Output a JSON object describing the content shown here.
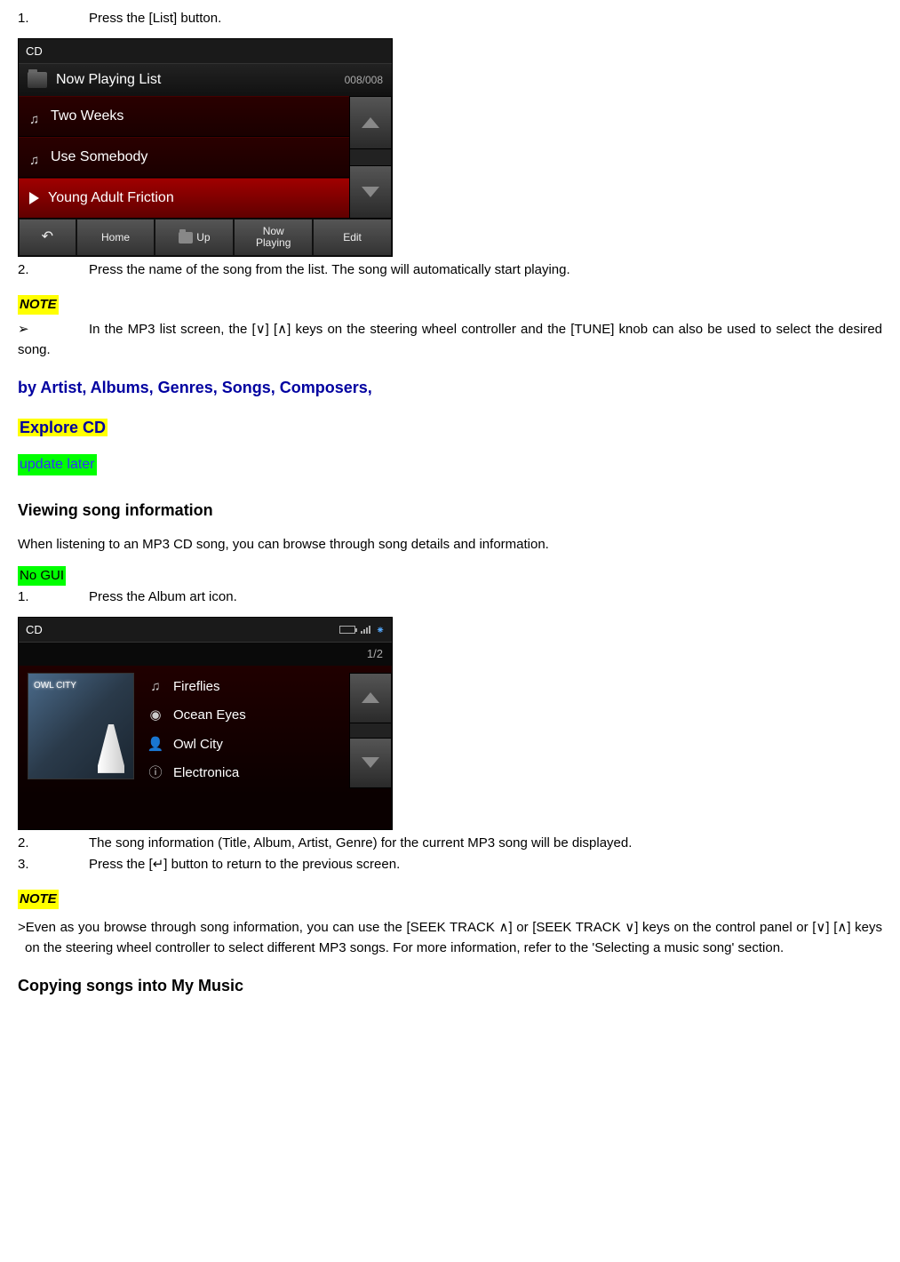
{
  "step1": {
    "num": "1.",
    "text": "Press the [List] button."
  },
  "screenshot1": {
    "header": "CD",
    "nowPlaying": "Now Playing List",
    "count": "008/008",
    "tracks": [
      "Two Weeks",
      "Use Somebody",
      "Young Adult Friction"
    ],
    "footer": {
      "home": "Home",
      "up": "Up",
      "nowPlaying": "Now\nPlaying",
      "edit": "Edit"
    }
  },
  "step2": {
    "num": "2.",
    "text": "Press the name of the song from the list. The song will automatically start playing."
  },
  "note1": {
    "label": "NOTE",
    "marker": "➢",
    "text": "In the MP3 list screen, the [∨] [∧] keys on the steering wheel controller and the [TUNE] knob can also be used to select the desired song."
  },
  "headingArtist": "by Artist, Albums, Genres, Songs, Composers,",
  "headingExplore": "Explore CD",
  "updateLater": "update later",
  "headingViewing": "Viewing song information",
  "paraViewing": "When listening to an MP3 CD song, you can browse through song details and information.",
  "noGui": "No GUI",
  "stepA1": {
    "num": "1.",
    "text": "Press the Album art icon."
  },
  "screenshot2": {
    "header": "CD",
    "page": "1/2",
    "albumTitle": "OWL CITY",
    "info": {
      "title": "Fireflies",
      "album": "Ocean Eyes",
      "artist": "Owl City",
      "genre": "Electronica"
    }
  },
  "stepA2": {
    "num": "2.",
    "text": "The song information (Title, Album, Artist, Genre) for the current MP3 song will be displayed."
  },
  "stepA3": {
    "num": "3.",
    "text": "Press the [↵] button to return to the previous screen."
  },
  "note2": {
    "label": "NOTE",
    "text": ">Even as you browse through song information, you can use the [SEEK TRACK ∧] or [SEEK TRACK ∨] keys on the control panel or [∨] [∧] keys on the steering wheel controller to select different MP3 songs. For more information, refer to the 'Selecting a music song' section."
  },
  "headingCopying": "Copying songs into My Music"
}
